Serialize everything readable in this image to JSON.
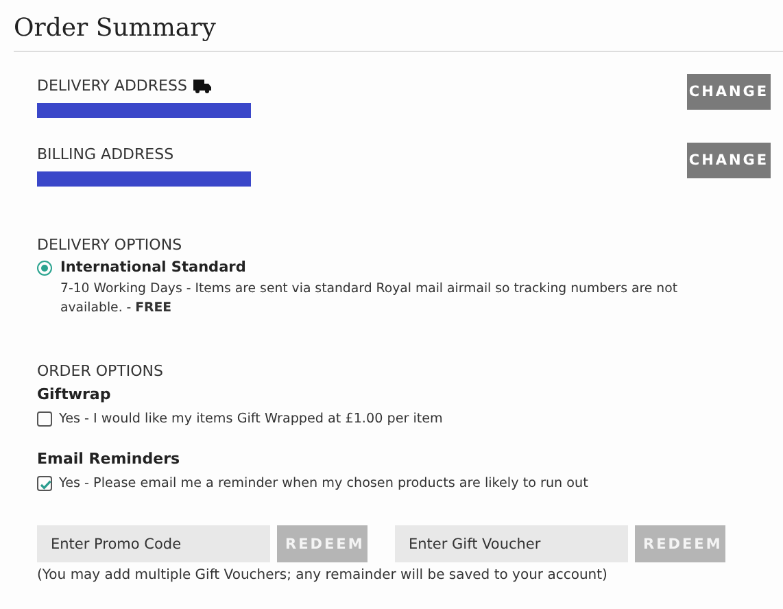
{
  "title": "Order Summary",
  "addresses": [
    {
      "label": "DELIVERY ADDRESS",
      "kind": "delivery",
      "redacted": true,
      "button": "CHANGE"
    },
    {
      "label": "BILLING ADDRESS",
      "kind": "billing",
      "redacted": true,
      "button": "CHANGE"
    }
  ],
  "delivery_options": {
    "heading": "DELIVERY OPTIONS",
    "options": [
      {
        "name": "International Standard",
        "description": "7-10 Working Days - Items are sent via standard Royal mail airmail so tracking numbers are not available. -",
        "price": "FREE",
        "selected": true
      }
    ]
  },
  "order_options": {
    "heading": "ORDER OPTIONS",
    "groups": [
      {
        "title": "Giftwrap",
        "label": "Yes - I would like my items Gift Wrapped at £1.00 per item",
        "checked": false
      },
      {
        "title": "Email Reminders",
        "label": "Yes - Please email me a reminder when my chosen products are likely to run out",
        "checked": true
      }
    ]
  },
  "codes": [
    {
      "placeholder": "Enter Promo Code",
      "button": "REDEEM"
    },
    {
      "placeholder": "Enter Gift Voucher",
      "button": "REDEEM"
    }
  ],
  "note": "(You may add multiple Gift Vouchers; any remainder will be saved to your account)"
}
